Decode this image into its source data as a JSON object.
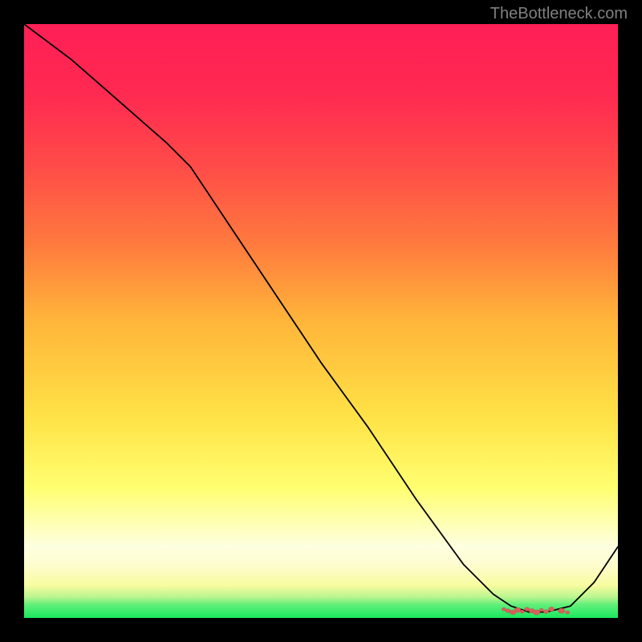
{
  "branding": {
    "watermark": "TheBottleneck.com"
  },
  "colors": {
    "curve_stroke": "#000000",
    "marker_fill": "#d8605b",
    "gradient_top": "#ff1f56",
    "gradient_bottom": "#18e85e"
  },
  "chart_data": {
    "type": "line",
    "title": "",
    "xlabel": "",
    "ylabel": "",
    "xlim": [
      0,
      100
    ],
    "ylim": [
      0,
      100
    ],
    "grid": false,
    "curve": {
      "x": [
        0,
        8,
        16,
        24,
        28,
        34,
        42,
        50,
        58,
        66,
        74,
        79,
        82,
        85,
        88,
        92,
        96,
        100
      ],
      "y": [
        100,
        94,
        87,
        80,
        76,
        67,
        55,
        43,
        32,
        20,
        9,
        4,
        2,
        1,
        1,
        2,
        6,
        12
      ]
    },
    "valley_markers": {
      "y": 1.2,
      "x": [
        80.8,
        81.5,
        82.3,
        83.1,
        83.9,
        84.7,
        85.5,
        86.3,
        87.1,
        87.9,
        88.8,
        90.5,
        91.5
      ]
    },
    "annotations": []
  }
}
